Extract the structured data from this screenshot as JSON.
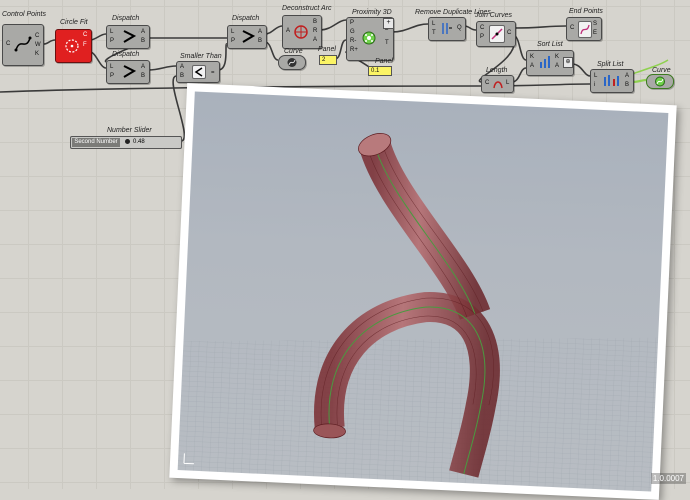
{
  "components": {
    "control_points": "Control Points",
    "circle_fit": "Circle Fit",
    "dispatch_1": "Dispatch",
    "dispatch_2": "Dispatch",
    "dispatch_3": "Dispatch",
    "smaller_than": "Smaller Than",
    "deconstruct_arc": "Deconstruct Arc",
    "curve_param": "Curve",
    "panel_label_1": "Panel",
    "proximity_3d": "Proximity 3D",
    "panel_label_2": "Panel",
    "remove_duplicate_lines": "Remove Duplicate Lines",
    "join_curves": "Join Curves",
    "end_points": "End Points",
    "sort_list": "Sort List",
    "length": "Length",
    "split_list": "Split List",
    "curve_out": "Curve"
  },
  "panels": {
    "panel_1_value": "2",
    "panel_2_value": "0.1"
  },
  "slider": {
    "name": "Second Number",
    "value": "0.48"
  },
  "viewport": {
    "version": "1.0.0007"
  },
  "colors": {
    "canvas": "#d6d4ce",
    "component": "#a9a9a6",
    "panel": "#fbf465",
    "circle_fit": "#e02020",
    "pipe": "#8a3b3e",
    "wire_selected": "#8fd14f"
  }
}
